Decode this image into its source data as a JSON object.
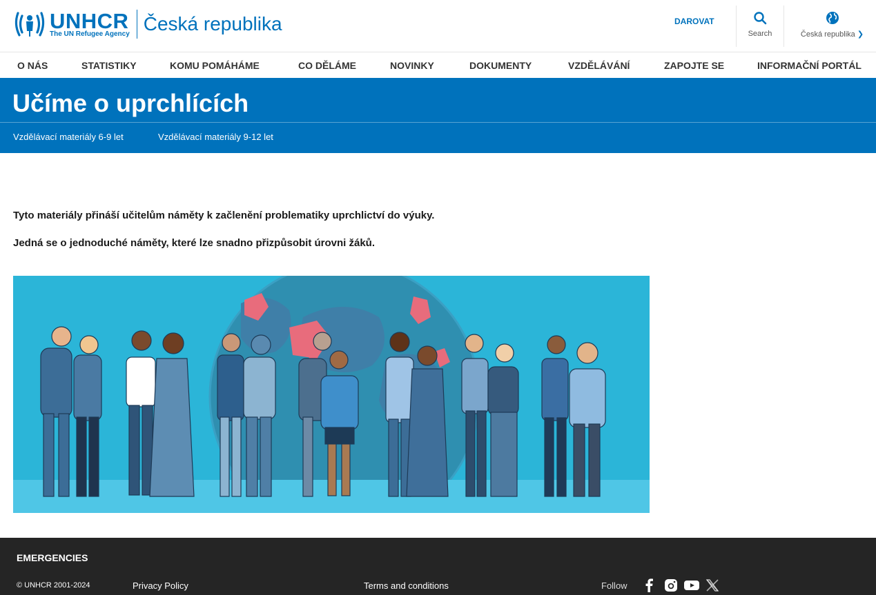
{
  "header": {
    "logo_main": "UNHCR",
    "logo_sub": "The UN Refugee Agency",
    "logo_country": "Česká republika",
    "donate_label": "DAROVAT",
    "search_label": "Search",
    "country_label": "Česká republika"
  },
  "nav": {
    "items": [
      "O NÁS",
      "STATISTIKY",
      "KOMU POMÁHÁME",
      "CO DĚLÁME",
      "NOVINKY",
      "DOKUMENTY",
      "VZDĚLÁVÁNÍ",
      "ZAPOJTE SE",
      "INFORMAČNÍ PORTÁL"
    ]
  },
  "hero": {
    "title": "Učíme o uprchlících",
    "subnav": [
      "Vzdělávací materiály 6-9 let",
      "Vzdělávací materiály 9-12 let"
    ]
  },
  "content": {
    "paragraph1": "Tyto materiály přináší učitelům náměty k začlenění problematiky uprchlictví do výuky.",
    "paragraph2": "Jedná se o jednoduché náměty, které lze snadno přizpůsobit úrovni žáků."
  },
  "footer": {
    "emergencies": "EMERGENCIES",
    "copyright": "© UNHCR 2001-2024",
    "privacy": "Privacy Policy",
    "terms": "Terms and conditions",
    "follow": "Follow",
    "social_icons": [
      "facebook-icon",
      "instagram-icon",
      "youtube-icon",
      "x-icon"
    ]
  },
  "colors": {
    "brand_blue": "#0072bc",
    "footer_bg": "#252525",
    "illustration_bg": "#2bb5d8"
  }
}
